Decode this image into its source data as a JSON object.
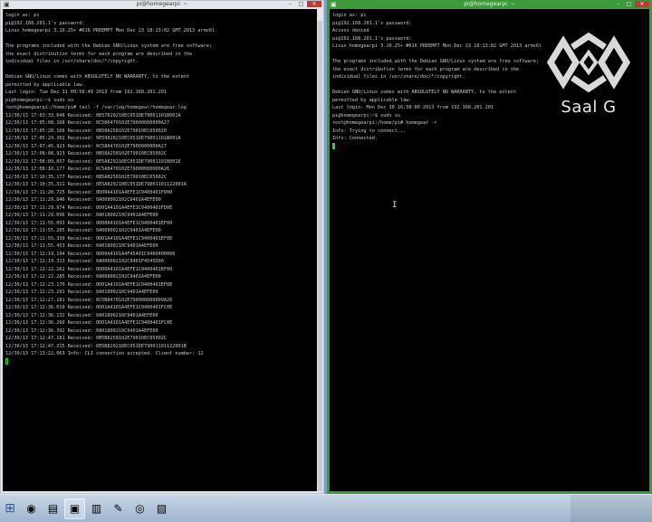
{
  "left_window": {
    "title": "pi@homegearpi: ~",
    "controls": {
      "minimize": "–",
      "maximize": "□",
      "close": "✕"
    },
    "lines": [
      "login as: pi",
      "pi@192.168.201.1's password:",
      "Linux homegearpi 3.10.25+ #616 PREEMPT Mon Dec 23 18:13:02 GMT 2013 armv6l",
      "",
      "The programs included with the Debian GNU/Linux system are free software;",
      "the exact distribution terms for each program are described in the",
      "individual files in /usr/share/doc/*/copyright.",
      "",
      "Debian GNU/Linux comes with ABSOLUTELY NO WARRANTY, to the extent",
      "permitted by applicable law.",
      "Last login: Tue Dec 31 09:58:49 2013 from 192.168.201.201",
      "pi@homegearpi:~$ sudo su",
      "root@homegearpi:/home/pi# tail -f /var/log/homegear/homegear.log",
      "12/30/13 17:03:33.046 Received: 0E57820210EC051DE79001101B001A",
      "12/30/13 17:05:08.168 Received: 0C586470102E79000000000A27",
      "12/30/13 17:05:28.168 Received: 0B58A258102E79010EC050020",
      "12/30/13 17:05:29.302 Received: 0E59820210EC051DE79001101B001A",
      "12/30/13 17:07:45.923 Received: 0C58A470102E7900000000A27",
      "12/30/13 17:08:08.923 Received: 0B58A258102E79010EC05002C",
      "12/30/13 17:08:09.057 Received: 0E5A820210EC051DE79001101B001E",
      "12/30/13 17:08:10.177 Received: 0C5A8470102E79000000000A26",
      "12/30/13 17:10:35.177 Received: 0B5A8258102E79010EC05002C",
      "12/30/13 17:10:35.311 Received: 0E5A820210EC051DE79001101122001A",
      "12/30/13 17:11:20.725 Received: 0D00A4101A4EFE1C9400401FD00",
      "12/30/13 17:11:29.846 Received: 0A008002102C9401A4EFE00",
      "12/30/13 17:11:29.974 Received: 0D01A4101A4EFE1C9400401FD0E",
      "12/30/13 17:11:29.096 Received: 0A01800210C9401A4EFE00",
      "12/30/13 17:11:55.093 Received: 0D00A4101A4EFE1C9400401EF00",
      "12/30/13 17:11:55.205 Received: 0A008002102C9401A4EFE00",
      "12/30/13 17:11:55.330 Received: 0D01A4101A4EFE1C9400401EF0E",
      "12/30/13 17:11:55.453 Received: 0A01800210C9401A4EFE00",
      "12/30/13 17:12:19.194 Received: 0D00A4101A4F45401C9400400000",
      "12/30/13 17:12:19.313 Received: 0A008002102C9401F4545D00",
      "12/30/13 17:12:22.162 Received: 0D00A4101A4EFE1C9400401EF00",
      "12/30/13 17:12:22.285 Received: 0A008002102C9401A4EFE00",
      "12/30/13 17:12:23.170 Received: 0D01A4101A4EFE1C9400401EF0E",
      "12/30/13 17:12:23.291 Received: 0A01800210C9401A4EFE00",
      "12/30/13 17:12:27.181 Received: 0C5B8470102E790000000000A26",
      "12/30/13 17:12:36.010 Received: 0D01A4101A4EFE1C9400401FC0E",
      "12/30/13 17:12:36.132 Received: 0A01800210C9401A4EFE00",
      "12/30/13 17:12:36.260 Received: 0D01A4101A4EFE1C9400401FC0E",
      "12/30/13 17:12:36.392 Received: 0A01800210C9401A4EFE00",
      "12/30/13 17:12:47.181 Received: 0B5B8258102E79010EC05002C",
      "12/30/13 17:12:47.315 Received: 0E5B820210EC051DE79001101122001B",
      "12/30/13 17:13:22.063 Info: CLI connection accepted. Client number: 12",
      ""
    ]
  },
  "right_window": {
    "title": "pi@homegearpi: ~",
    "controls": {
      "minimize": "–",
      "maximize": "□",
      "close": "✕"
    },
    "lines": [
      "login as: pi",
      "pi@192.168.201.1's password:",
      "Access denied",
      "pi@192.168.201.1's password:",
      "Linux homegearpi 3.10.25+ #616 PREEMPT Mon Dec 23 18:13:02 GMT 2013 armv6l",
      "",
      "The programs included with the Debian GNU/Linux system are free software;",
      "the exact distribution terms for each program are described in the",
      "individual files in /usr/share/doc/*/copyright.",
      "",
      "Debian GNU/Linux comes with ABSOLUTELY NO WARRANTY, to the extent",
      "permitted by applicable law.",
      "Last login: Mon Dec 30 16:38:00 2013 from 192.168.201.201",
      "pi@homegearpi:~$ sudo su",
      "root@homegearpi:/home/pi# homegear -r",
      "Info: Trying to connect...",
      "Info: Connected.",
      ""
    ],
    "logo_text": "Saal G"
  },
  "taskbar": {
    "items": [
      {
        "icon": "windows-start-icon",
        "glyph": "⊞"
      },
      {
        "icon": "firefox-icon",
        "glyph": "◉"
      },
      {
        "icon": "file-explorer-icon",
        "glyph": "▤"
      },
      {
        "icon": "putty-icon",
        "glyph": "▣"
      },
      {
        "icon": "document-viewer-icon",
        "glyph": "▥"
      },
      {
        "icon": "network-tool-icon",
        "glyph": "✎"
      },
      {
        "icon": "recorder-icon",
        "glyph": "◎"
      },
      {
        "icon": "pdf-icon",
        "glyph": "▧"
      }
    ]
  },
  "colors": {
    "terminal_bg": "#000000",
    "terminal_text": "#c8c8c8",
    "cursor": "#2fd42f",
    "right_frame": "#3b9a3a"
  }
}
